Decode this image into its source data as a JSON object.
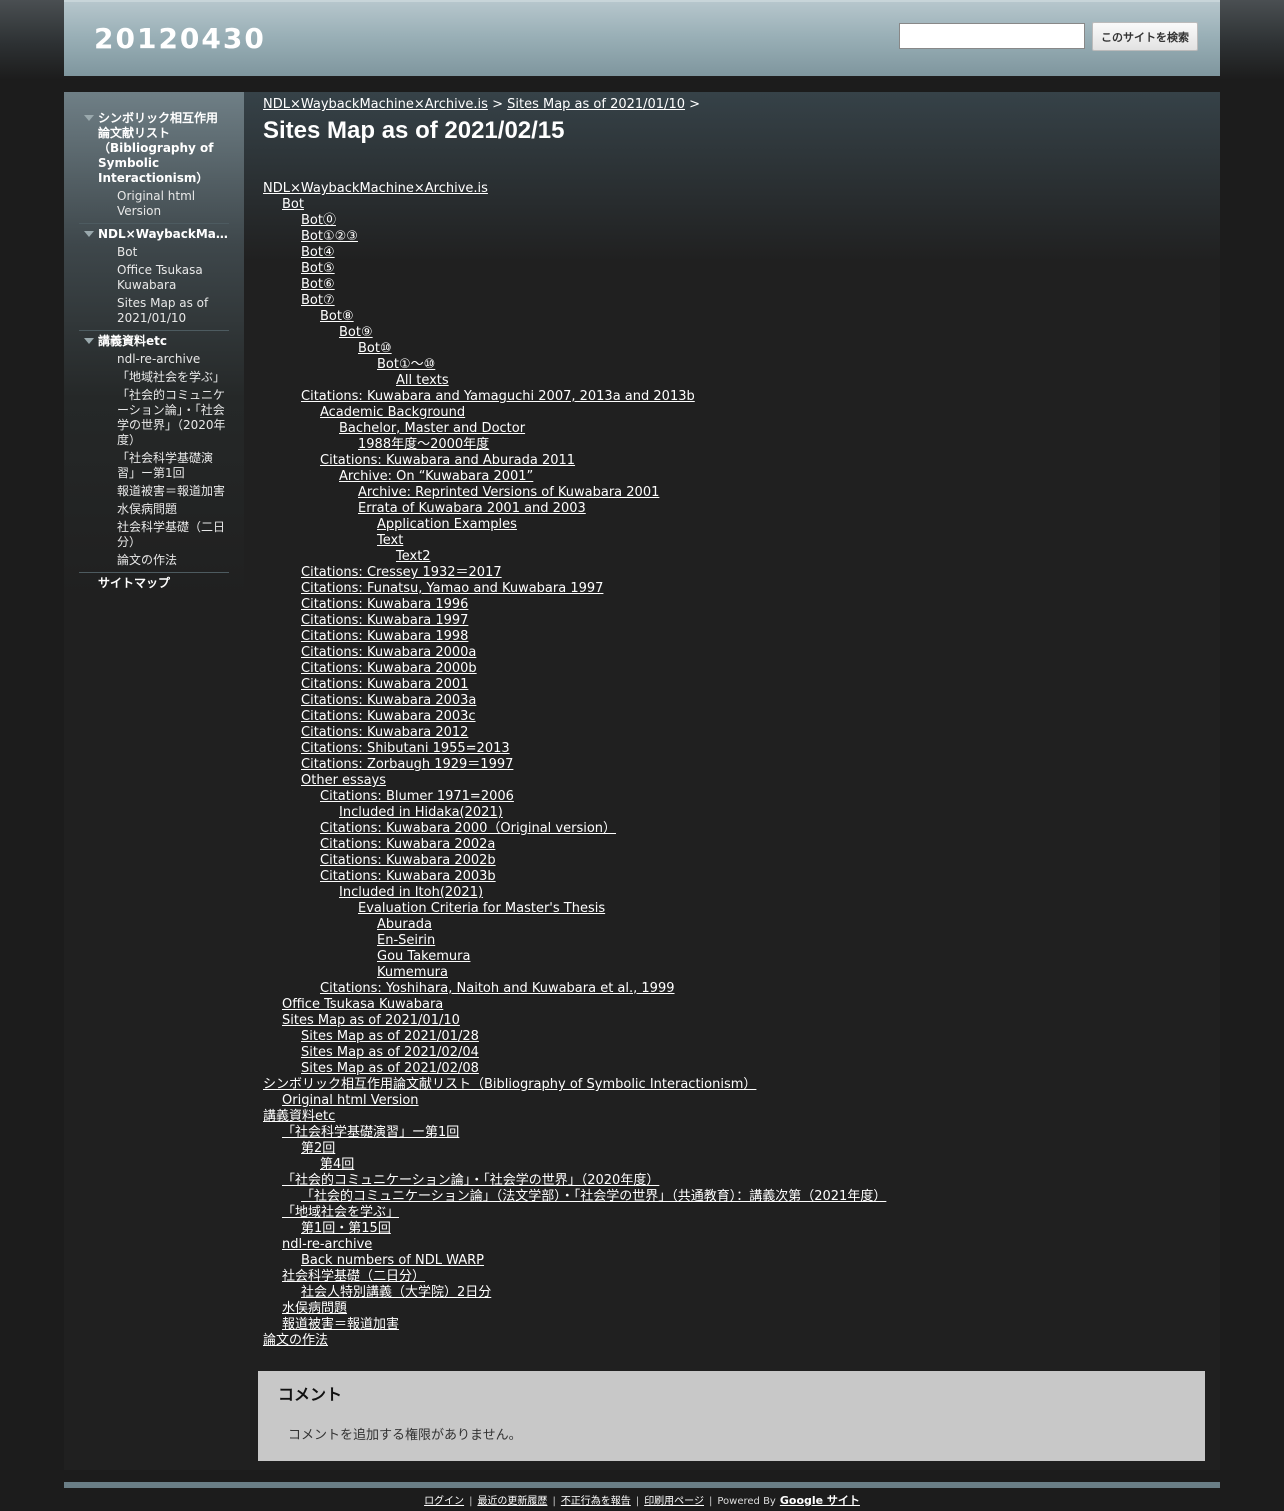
{
  "site": {
    "title": "20120430"
  },
  "search": {
    "placeholder": "",
    "button_label": "このサイトを検索"
  },
  "sidebar": {
    "groups": [
      {
        "label": "シンボリック相互作用論文献リスト（Bibliography of Symbolic Interactionism）",
        "children": [
          "Original html Version"
        ]
      },
      {
        "label": "NDL×WaybackMachine×Archive.is",
        "children": [
          "Bot",
          "Office Tsukasa Kuwabara",
          "Sites Map as of 2021/01/10"
        ]
      },
      {
        "label": "講義資料etc",
        "children": [
          "ndl-re-archive",
          "「地域社会を学ぶ」",
          "「社会的コミュニケーション論」・「社会学の世界」（2020年度）",
          "「社会科学基礎演習」ー第1回",
          "報道被害＝報道加害",
          "水俣病問題",
          "社会科学基礎（二日分）",
          "論文の作法"
        ]
      }
    ],
    "sitemap_label": "サイトマップ"
  },
  "breadcrumb": {
    "items": [
      "NDL×WaybackMachine×Archive.is",
      "Sites Map as of 2021/01/10"
    ],
    "separator": ">"
  },
  "page": {
    "title": "Sites Map as of 2021/02/15"
  },
  "tree": [
    {
      "label": "NDL×WaybackMachine×Archive.is",
      "level": 0
    },
    {
      "label": "Bot",
      "level": 1
    },
    {
      "label": "Bot⓪",
      "level": 2
    },
    {
      "label": "Bot①②③",
      "level": 2
    },
    {
      "label": "Bot④",
      "level": 2
    },
    {
      "label": "Bot⑤",
      "level": 2
    },
    {
      "label": "Bot⑥",
      "level": 2
    },
    {
      "label": "Bot⑦",
      "level": 2
    },
    {
      "label": "Bot⑧",
      "level": 3
    },
    {
      "label": "Bot⑨",
      "level": 4
    },
    {
      "label": "Bot⑩",
      "level": 5
    },
    {
      "label": "Bot①～⑩",
      "level": 6
    },
    {
      "label": "All texts",
      "level": 7
    },
    {
      "label": "Citations: Kuwabara and Yamaguchi 2007, 2013a and 2013b",
      "level": 2
    },
    {
      "label": "Academic Background",
      "level": 3
    },
    {
      "label": "Bachelor, Master and Doctor",
      "level": 4
    },
    {
      "label": "1988年度～2000年度",
      "level": 5
    },
    {
      "label": "Citations: Kuwabara and Aburada 2011",
      "level": 3
    },
    {
      "label": "Archive: On “Kuwabara 2001”",
      "level": 4
    },
    {
      "label": "Archive: Reprinted Versions of Kuwabara 2001",
      "level": 5
    },
    {
      "label": "Errata of Kuwabara 2001 and 2003",
      "level": 5
    },
    {
      "label": "Application Examples",
      "level": 6
    },
    {
      "label": "Text",
      "level": 6
    },
    {
      "label": "Text2",
      "level": 7
    },
    {
      "label": "Citations: Cressey 1932＝2017",
      "level": 2
    },
    {
      "label": "Citations: Funatsu, Yamao and Kuwabara 1997",
      "level": 2
    },
    {
      "label": "Citations: Kuwabara 1996",
      "level": 2
    },
    {
      "label": "Citations: Kuwabara 1997",
      "level": 2
    },
    {
      "label": "Citations: Kuwabara 1998",
      "level": 2
    },
    {
      "label": "Citations: Kuwabara 2000a",
      "level": 2
    },
    {
      "label": "Citations: Kuwabara 2000b",
      "level": 2
    },
    {
      "label": "Citations: Kuwabara 2001",
      "level": 2
    },
    {
      "label": "Citations: Kuwabara 2003a",
      "level": 2
    },
    {
      "label": "Citations: Kuwabara 2003c",
      "level": 2
    },
    {
      "label": "Citations: Kuwabara 2012",
      "level": 2
    },
    {
      "label": "Citations: Shibutani 1955=2013",
      "level": 2
    },
    {
      "label": "Citations: Zorbaugh 1929＝1997",
      "level": 2
    },
    {
      "label": "Other essays",
      "level": 2
    },
    {
      "label": "Citations: Blumer 1971=2006",
      "level": 3
    },
    {
      "label": "Included in Hidaka(2021)",
      "level": 4
    },
    {
      "label": "Citations: Kuwabara 2000（Original version）",
      "level": 3
    },
    {
      "label": "Citations: Kuwabara 2002a",
      "level": 3
    },
    {
      "label": "Citations: Kuwabara 2002b",
      "level": 3
    },
    {
      "label": "Citations: Kuwabara 2003b",
      "level": 3
    },
    {
      "label": "Included in Itoh(2021)",
      "level": 4
    },
    {
      "label": "Evaluation Criteria for Master's Thesis",
      "level": 5
    },
    {
      "label": "Aburada",
      "level": 6
    },
    {
      "label": "En-Seirin",
      "level": 6
    },
    {
      "label": "Gou Takemura",
      "level": 6
    },
    {
      "label": "Kumemura",
      "level": 6
    },
    {
      "label": "Citations: Yoshihara, Naitoh and Kuwabara et al., 1999",
      "level": 3
    },
    {
      "label": "Office Tsukasa Kuwabara",
      "level": 1
    },
    {
      "label": "Sites Map as of 2021/01/10",
      "level": 1
    },
    {
      "label": "Sites Map as of 2021/01/28",
      "level": 2
    },
    {
      "label": "Sites Map as of 2021/02/04",
      "level": 2
    },
    {
      "label": "Sites Map as of 2021/02/08",
      "level": 2
    },
    {
      "label": "シンボリック相互作用論文献リスト（Bibliography of Symbolic Interactionism）",
      "level": 0
    },
    {
      "label": "Original html Version",
      "level": 1
    },
    {
      "label": "講義資料etc",
      "level": 0
    },
    {
      "label": "「社会科学基礎演習」ー第1回",
      "level": 1
    },
    {
      "label": "第2回",
      "level": 2
    },
    {
      "label": "第4回",
      "level": 3
    },
    {
      "label": "「社会的コミュニケーション論」・「社会学の世界」（2020年度）",
      "level": 1
    },
    {
      "label": "「社会的コミュニケーション論」（法文学部）・「社会学の世界」（共通教育）：講義次第（2021年度）",
      "level": 2
    },
    {
      "label": "「地域社会を学ぶ」",
      "level": 1
    },
    {
      "label": "第1回・第15回",
      "level": 2
    },
    {
      "label": "ndl-re-archive",
      "level": 1
    },
    {
      "label": "Back numbers of NDL WARP",
      "level": 2
    },
    {
      "label": "社会科学基礎（二日分）",
      "level": 1
    },
    {
      "label": "社会人特別講義（大学院）2日分",
      "level": 2
    },
    {
      "label": "水俣病問題",
      "level": 1
    },
    {
      "label": "報道被害＝報道加害",
      "level": 1
    },
    {
      "label": "論文の作法",
      "level": 0
    }
  ],
  "comments": {
    "title": "コメント",
    "note": "コメントを追加する権限がありません。"
  },
  "footer": {
    "links": [
      "ログイン",
      "最近の更新履歴",
      "不正行為を報告",
      "印刷用ページ"
    ],
    "powered_by": "Powered By",
    "google_sites": "Google サイト"
  }
}
